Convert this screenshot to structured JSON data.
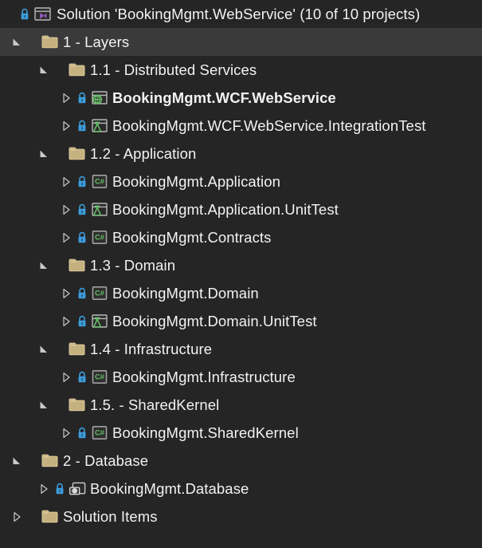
{
  "window": {
    "title": "Solution Explorer",
    "background_color": "#252526",
    "selected_row_color": "#3a3a3a",
    "text_color": "#f2f2f2",
    "folder_color": "#c5b180",
    "lock_color": "#3c9ddb",
    "csharp_green": "#66c266",
    "vs_purple": "#a05fd0"
  },
  "solution": {
    "label": "Solution 'BookingMgmt.WebService' (10 of 10 projects)",
    "name": "BookingMgmt.WebService",
    "project_count": "10 of 10 projects",
    "icon": "visual-studio-solution-icon",
    "locked": true,
    "expanded": true
  },
  "rows": [
    {
      "label": "Solution 'BookingMgmt.WebService' (10 of 10 projects)",
      "depth": 0,
      "icon": "visual-studio-solution-icon",
      "expander": "none",
      "lock": true,
      "bold": false,
      "selected": false,
      "name": "solution-root"
    },
    {
      "label": "1 - Layers",
      "depth": 1,
      "icon": "folder-icon",
      "expander": "expanded",
      "lock": false,
      "bold": false,
      "selected": true,
      "name": "solution-folder-1-layers"
    },
    {
      "label": "1.1 - Distributed Services",
      "depth": 2,
      "icon": "folder-icon",
      "expander": "expanded",
      "lock": false,
      "bold": false,
      "selected": false,
      "name": "solution-folder-1-1-distributed-services"
    },
    {
      "label": "BookingMgmt.WCF.WebService",
      "depth": 3,
      "icon": "web-service-project-icon",
      "expander": "collapsed",
      "lock": true,
      "bold": true,
      "selected": false,
      "name": "project-bookingmgmt-wcf-webservice"
    },
    {
      "label": "BookingMgmt.WCF.WebService.IntegrationTest",
      "depth": 3,
      "icon": "test-project-icon",
      "expander": "collapsed",
      "lock": true,
      "bold": false,
      "selected": false,
      "name": "project-bookingmgmt-wcf-webservice-integrationtest"
    },
    {
      "label": "1.2 - Application",
      "depth": 2,
      "icon": "folder-icon",
      "expander": "expanded",
      "lock": false,
      "bold": false,
      "selected": false,
      "name": "solution-folder-1-2-application"
    },
    {
      "label": "BookingMgmt.Application",
      "depth": 3,
      "icon": "csharp-project-icon",
      "expander": "collapsed",
      "lock": true,
      "bold": false,
      "selected": false,
      "name": "project-bookingmgmt-application"
    },
    {
      "label": "BookingMgmt.Application.UnitTest",
      "depth": 3,
      "icon": "test-project-icon",
      "expander": "collapsed",
      "lock": true,
      "bold": false,
      "selected": false,
      "name": "project-bookingmgmt-application-unittest"
    },
    {
      "label": "BookingMgmt.Contracts",
      "depth": 3,
      "icon": "csharp-project-icon",
      "expander": "collapsed",
      "lock": true,
      "bold": false,
      "selected": false,
      "name": "project-bookingmgmt-contracts"
    },
    {
      "label": "1.3 - Domain",
      "depth": 2,
      "icon": "folder-icon",
      "expander": "expanded",
      "lock": false,
      "bold": false,
      "selected": false,
      "name": "solution-folder-1-3-domain"
    },
    {
      "label": "BookingMgmt.Domain",
      "depth": 3,
      "icon": "csharp-project-icon",
      "expander": "collapsed",
      "lock": true,
      "bold": false,
      "selected": false,
      "name": "project-bookingmgmt-domain"
    },
    {
      "label": "BookingMgmt.Domain.UnitTest",
      "depth": 3,
      "icon": "test-project-icon",
      "expander": "collapsed",
      "lock": true,
      "bold": false,
      "selected": false,
      "name": "project-bookingmgmt-domain-unittest"
    },
    {
      "label": "1.4 - Infrastructure",
      "depth": 2,
      "icon": "folder-icon",
      "expander": "expanded",
      "lock": false,
      "bold": false,
      "selected": false,
      "name": "solution-folder-1-4-infrastructure"
    },
    {
      "label": "BookingMgmt.Infrastructure",
      "depth": 3,
      "icon": "csharp-project-icon",
      "expander": "collapsed",
      "lock": true,
      "bold": false,
      "selected": false,
      "name": "project-bookingmgmt-infrastructure"
    },
    {
      "label": "1.5. - SharedKernel",
      "depth": 2,
      "icon": "folder-icon",
      "expander": "expanded",
      "lock": false,
      "bold": false,
      "selected": false,
      "name": "solution-folder-1-5-sharedkernel"
    },
    {
      "label": "BookingMgmt.SharedKernel",
      "depth": 3,
      "icon": "csharp-project-icon",
      "expander": "collapsed",
      "lock": true,
      "bold": false,
      "selected": false,
      "name": "project-bookingmgmt-sharedkernel"
    },
    {
      "label": "2 - Database",
      "depth": 1,
      "icon": "folder-icon",
      "expander": "expanded",
      "lock": false,
      "bold": false,
      "selected": false,
      "name": "solution-folder-2-database"
    },
    {
      "label": "BookingMgmt.Database",
      "depth": 2,
      "icon": "database-project-icon",
      "expander": "collapsed",
      "lock": true,
      "bold": false,
      "selected": false,
      "name": "project-bookingmgmt-database"
    },
    {
      "label": "Solution Items",
      "depth": 1,
      "icon": "folder-icon",
      "expander": "collapsed",
      "lock": false,
      "bold": false,
      "selected": false,
      "name": "solution-folder-solution-items"
    }
  ]
}
